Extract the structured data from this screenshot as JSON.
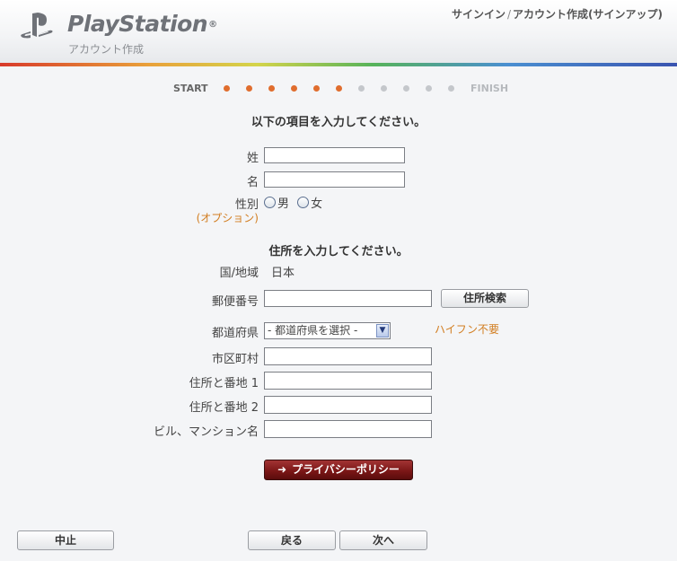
{
  "header": {
    "brand": "PlayStation",
    "brand_mark": "®",
    "subtitle": "アカウント作成",
    "nav_signin": "サインイン",
    "nav_sep": "/",
    "nav_signup": "アカウント作成(サインアップ)"
  },
  "progress": {
    "start_label": "START",
    "finish_label": "FINISH",
    "total_steps": 11,
    "completed_steps": 6
  },
  "form": {
    "heading": "以下の項目を入力してください。",
    "last_name_label": "姓",
    "last_name_value": "",
    "first_name_label": "名",
    "first_name_value": "",
    "gender_label": "性別",
    "gender_male": "男",
    "gender_female": "女",
    "optional_note": "(オプション)"
  },
  "address": {
    "heading": "住所を入力してください。",
    "country_label": "国/地域",
    "country_value": "日本",
    "postal_label": "郵便番号",
    "postal_value": "",
    "search_button": "住所検索",
    "prefecture_label": "都道府県",
    "prefecture_selected": "- 都道府県を選択 -",
    "hyphen_hint": "ハイフン不要",
    "city_label": "市区町村",
    "city_value": "",
    "address1_label": "住所と番地 1",
    "address1_value": "",
    "address2_label": "住所と番地 2",
    "address2_value": "",
    "building_label": "ビル、マンション名",
    "building_value": ""
  },
  "privacy_button": "プライバシーポリシー",
  "footer": {
    "cancel": "中止",
    "back": "戻る",
    "next": "次へ"
  },
  "colors": {
    "accent_orange": "#e06d2e",
    "step_inactive": "#c4c7cb",
    "privacy_button": "#7c1717",
    "note_text": "#d27d20"
  }
}
